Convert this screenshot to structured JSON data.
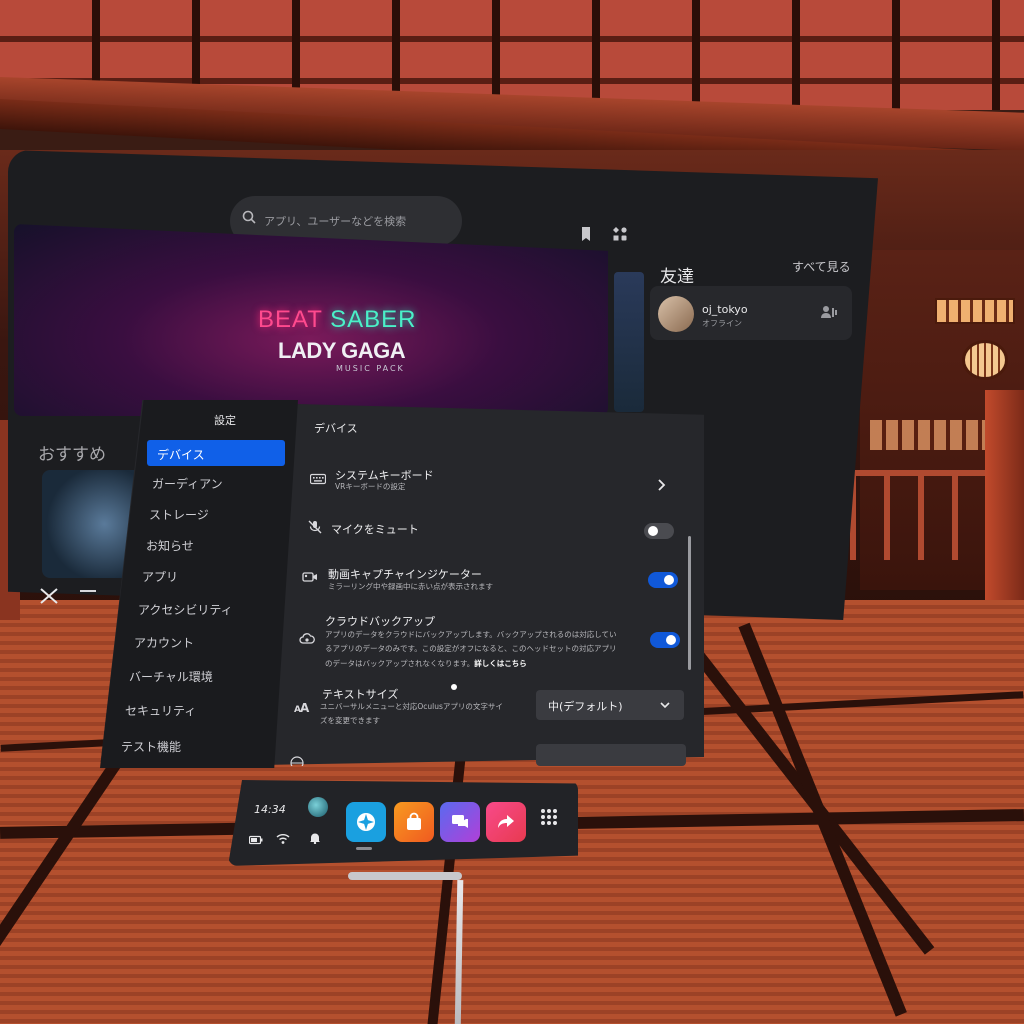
{
  "home": {
    "search_placeholder": "アプリ、ユーザーなどを検索",
    "hero": {
      "title_part1": "BEAT",
      "title_part2": "SABER",
      "artist": "LADY GAGA",
      "subtitle": "MUSIC PACK"
    },
    "friends": {
      "title": "友達",
      "see_all": "すべて見る",
      "list": [
        {
          "name": "oj_tokyo",
          "status": "オフライン"
        }
      ]
    },
    "recommended_title": "おすすめ"
  },
  "settings": {
    "title": "設定",
    "sidebar": [
      {
        "label": "デバイス",
        "active": true
      },
      {
        "label": "ガーディアン"
      },
      {
        "label": "ストレージ"
      },
      {
        "label": "お知らせ"
      },
      {
        "label": "アプリ"
      },
      {
        "label": "アクセシビリティ"
      },
      {
        "label": "アカウント"
      },
      {
        "label": "バーチャル環境"
      },
      {
        "label": "セキュリティ"
      },
      {
        "label": "テスト機能"
      }
    ],
    "pane_title": "デバイス",
    "rows": {
      "keyboard": {
        "label": "システムキーボード",
        "desc": "VRキーボードの設定"
      },
      "mic": {
        "label": "マイクをミュート",
        "enabled": false
      },
      "capture": {
        "label": "動画キャプチャインジケーター",
        "desc": "ミラーリング中や録画中に赤い点が表示されます",
        "enabled": true
      },
      "backup": {
        "label": "クラウドバックアップ",
        "desc_line1": "アプリのデータをクラウドにバックアップします。バックアップされるのは対応してい",
        "desc_line2": "るアプリのデータのみです。この設定がオフになると、このヘッドセットの対応アプリ",
        "desc_line3": "のデータはバックアップされなくなります。",
        "link": "詳しくはこちら",
        "enabled": true
      },
      "text_size": {
        "label": "テキストサイズ",
        "desc_line1": "ユニバーサルメニューと対応Oculusアプリの文字サイ",
        "desc_line2": "ズを変更できます",
        "value": "中(デフォルト)"
      }
    }
  },
  "taskbar": {
    "time": "14:34",
    "apps": [
      "explore-app",
      "store-app",
      "social-app",
      "share-app"
    ]
  },
  "colors": {
    "accent": "#1060e8",
    "explore": "#1aa0e0",
    "store": "#f07020",
    "social": "#8a4ae0",
    "share": "#f03a6a"
  }
}
